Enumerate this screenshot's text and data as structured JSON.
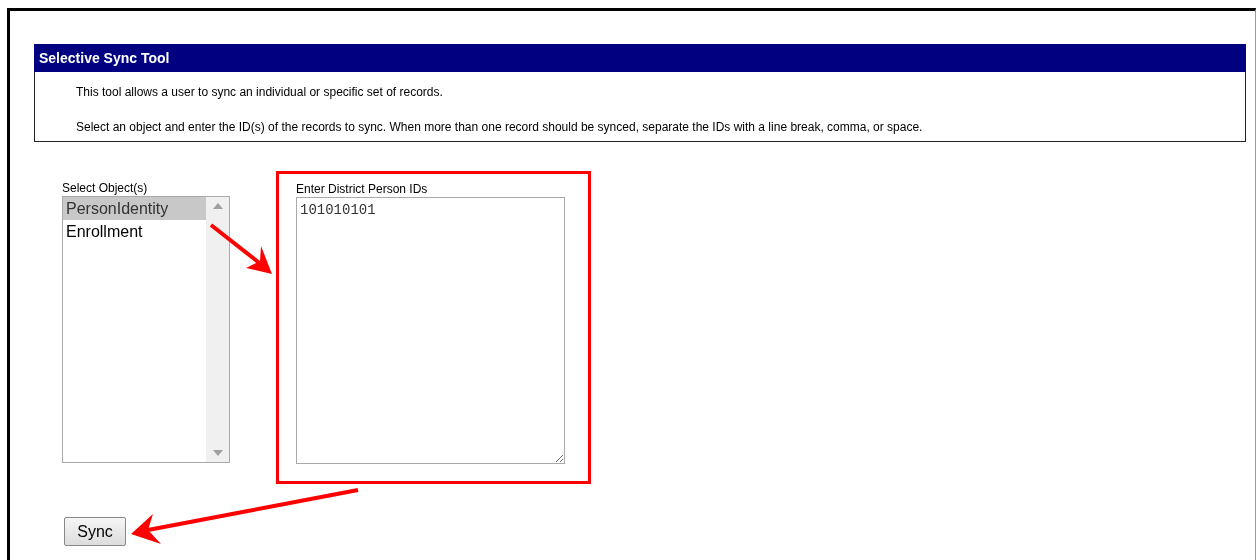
{
  "panel": {
    "title": "Selective Sync Tool",
    "description": [
      "This tool allows a user to sync an individual or specific set of records.",
      "Select an object and enter the ID(s) of the records to sync. When more than one record should be synced, separate the IDs with a line break, comma, or space."
    ]
  },
  "object_list": {
    "label": "Select Object(s)",
    "options": [
      {
        "label": "PersonIdentity",
        "selected": true
      },
      {
        "label": "Enrollment",
        "selected": false
      }
    ]
  },
  "ids_field": {
    "label": "Enter District Person IDs",
    "value": "101010101"
  },
  "buttons": [
    "Sync"
  ]
}
